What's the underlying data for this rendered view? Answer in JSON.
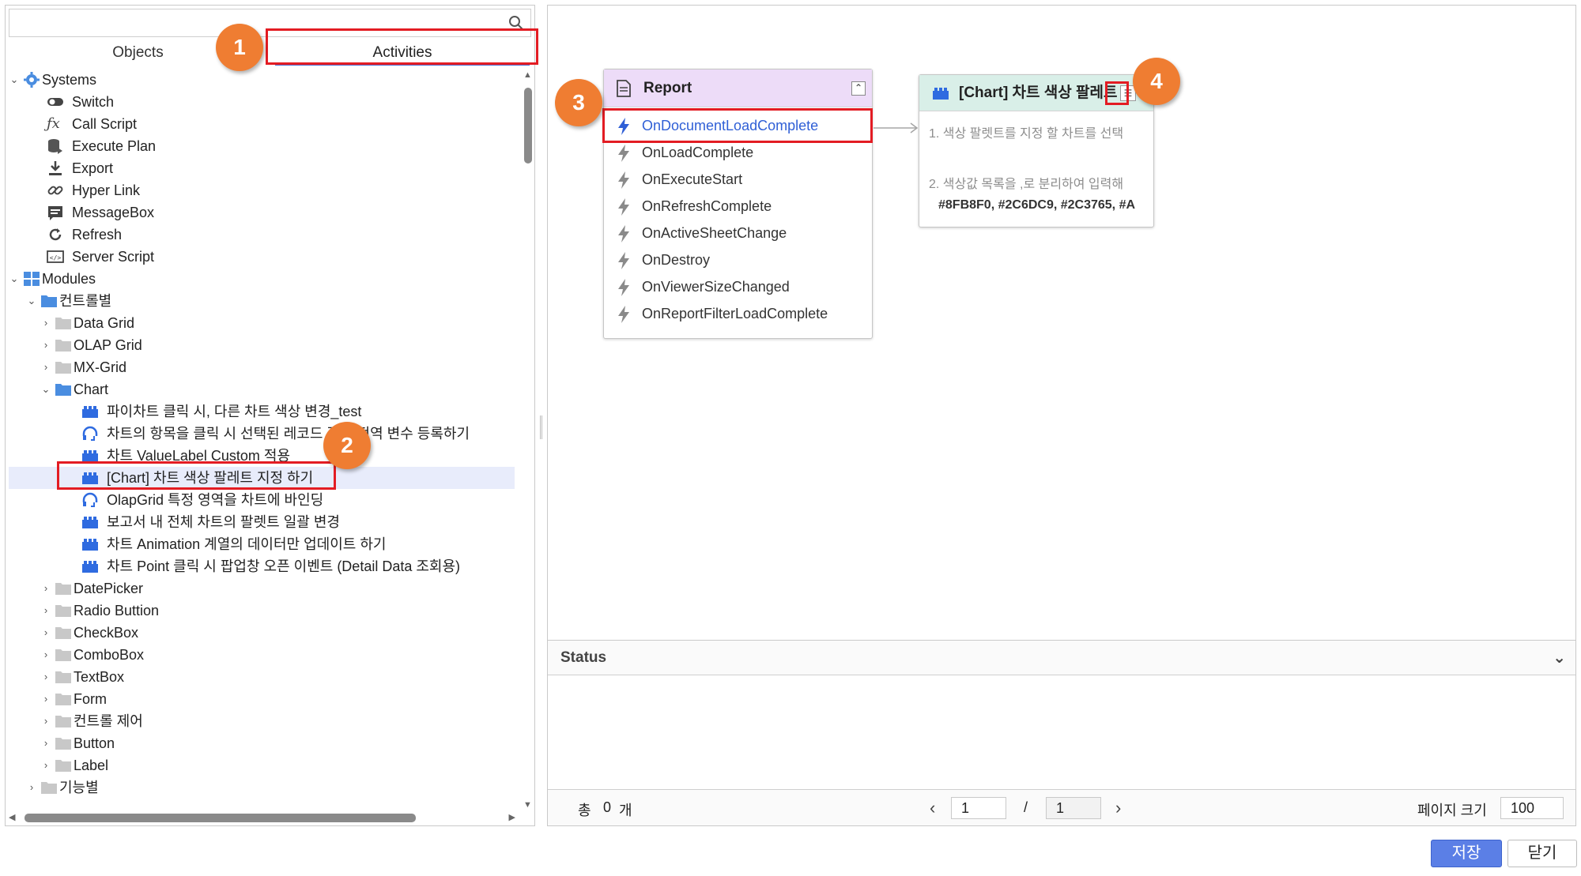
{
  "left_panel": {
    "search_placeholder": "",
    "tabs": [
      "Objects",
      "Activities"
    ],
    "tree": {
      "systems": {
        "label": "Systems",
        "items": [
          "Switch",
          "Call Script",
          "Execute Plan",
          "Export",
          "Hyper Link",
          "MessageBox",
          "Refresh",
          "Server Script"
        ]
      },
      "modules": {
        "label": "Modules",
        "by_control": "컨트롤별",
        "folders_a": [
          "Data Grid",
          "OLAP Grid",
          "MX-Grid"
        ],
        "chart_label": "Chart",
        "chart_items": [
          "파이차트 클릭 시, 다른 차트 색상 변경_test",
          "차트의 항목을 클릭 시 선택된 레코드 값을 전역 변수 등록하기",
          "차트 ValueLabel Custom 적용",
          "[Chart] 차트 색상 팔레트 지정 하기",
          "OlapGrid 특정 영역을 차트에 바인딩",
          "보고서 내 전체 차트의 팔렛트 일괄 변경",
          "차트 Animation 계열의 데이터만 업데이트 하기",
          "차트 Point 클릭 시 팝업창 오픈 이벤트 (Detail Data 조회용)"
        ],
        "folders_b": [
          "DatePicker",
          "Radio Buttion",
          "CheckBox",
          "ComboBox",
          "TextBox",
          "Form",
          "컨트롤 제어",
          "Button",
          "Label"
        ],
        "by_function": "기능별"
      }
    }
  },
  "report_node": {
    "title": "Report",
    "events": [
      "OnDocumentLoadComplete",
      "OnLoadComplete",
      "OnExecuteStart",
      "OnRefreshComplete",
      "OnActiveSheetChange",
      "OnDestroy",
      "OnViewerSizeChanged",
      "OnReportFilterLoadComplete"
    ]
  },
  "chart_node": {
    "title": "[Chart] 차트 색상 팔레트",
    "line1": "1. 색상 팔렛트를 지정 할 차트를 선택",
    "line2": "2. 색상값 목록을 ,로 분리하여 입력해",
    "colors": "#8FB8F0, #2C6DC9, #2C3765, #A"
  },
  "status": {
    "title": "Status",
    "total_label": "총",
    "total_count": "0",
    "total_unit": "개",
    "page_current": "1",
    "page_sep": "/",
    "page_total": "1",
    "page_size_label": "페이지 크기",
    "page_size": "100"
  },
  "buttons": {
    "save": "저장",
    "close": "닫기"
  },
  "markers": [
    "1",
    "2",
    "3",
    "4"
  ],
  "colors": {
    "accent": "#5b7fe6",
    "highlight_red": "#e31c23",
    "marker_orange": "#ef7d32",
    "report_head": "#eddcf8",
    "chart_head": "#d9efe8",
    "active_event": "#2f5fd6"
  }
}
